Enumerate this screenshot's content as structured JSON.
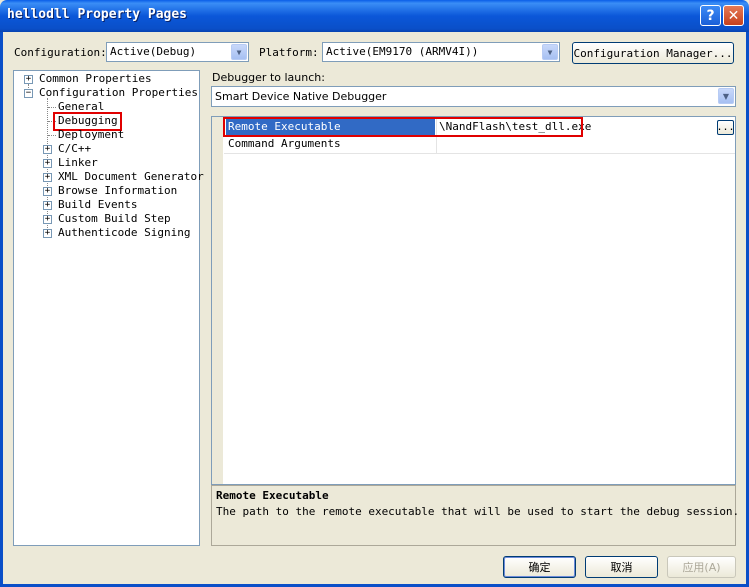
{
  "window": {
    "title": "hellodll Property Pages",
    "help_label": "?",
    "close_label": "✕"
  },
  "toolbar": {
    "configuration_label": "Configuration:",
    "configuration_value": "Active(Debug)",
    "platform_label": "Platform:",
    "platform_value": "Active(EM9170 (ARMV4I))",
    "config_manager_label": "Configuration Manager..."
  },
  "tree": {
    "items": [
      {
        "label": "Common Properties",
        "expander": "+"
      },
      {
        "label": "Configuration Properties",
        "expander": "−"
      },
      {
        "label": "General"
      },
      {
        "label": "Debugging"
      },
      {
        "label": "Deployment"
      },
      {
        "label": "C/C++",
        "expander": "+"
      },
      {
        "label": "Linker",
        "expander": "+"
      },
      {
        "label": "XML Document Generator",
        "expander": "+"
      },
      {
        "label": "Browse Information",
        "expander": "+"
      },
      {
        "label": "Build Events",
        "expander": "+"
      },
      {
        "label": "Custom Build Step",
        "expander": "+"
      },
      {
        "label": "Authenticode Signing",
        "expander": "+"
      }
    ]
  },
  "debugger": {
    "label": "Debugger to launch:",
    "value": "Smart Device Native Debugger"
  },
  "grid": {
    "rows": [
      {
        "name": "Remote Executable",
        "value": "\\NandFlash\\test_dll.exe"
      },
      {
        "name": "Command Arguments",
        "value": ""
      }
    ],
    "browse_label": "..."
  },
  "description": {
    "title": "Remote Executable",
    "text": "The path to the remote executable that will be used to start the debug session."
  },
  "buttons": {
    "ok": "确定",
    "cancel": "取消",
    "apply": "应用(A)"
  }
}
